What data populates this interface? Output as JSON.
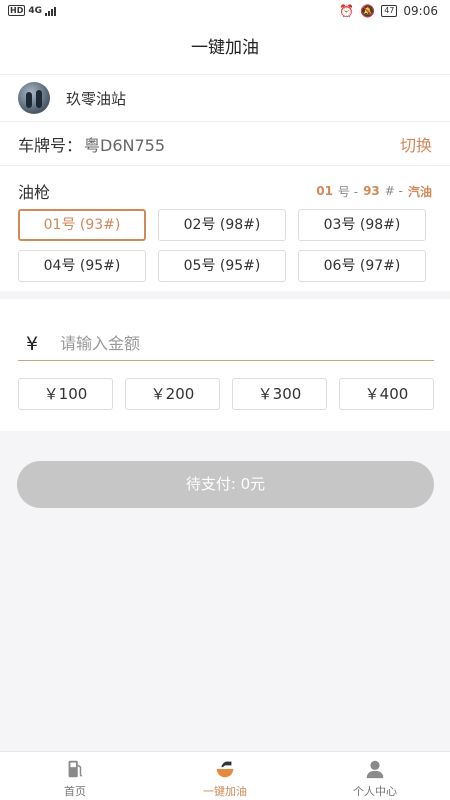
{
  "status_bar": {
    "hd": "HD",
    "network": "4G",
    "battery": "47",
    "time": "09:06"
  },
  "header": {
    "title": "一键加油"
  },
  "station": {
    "name": "玖零油站"
  },
  "plate": {
    "label": "车牌号：",
    "value": "粤D6N755",
    "switch_label": "切换"
  },
  "nozzles": {
    "title": "油枪",
    "summary": {
      "number": "01",
      "number_suffix": "号 -",
      "grade": "93",
      "grade_suffix": "# -",
      "fuel": "汽油"
    },
    "items": [
      {
        "label": "01号 (93#)"
      },
      {
        "label": "02号 (98#)"
      },
      {
        "label": "03号 (98#)"
      },
      {
        "label": "04号 (95#)"
      },
      {
        "label": "05号 (95#)"
      },
      {
        "label": "06号 (97#)"
      }
    ],
    "selected_index": 0
  },
  "amount": {
    "currency_symbol": "¥",
    "placeholder": "请输入金额",
    "quick_amounts": [
      {
        "label": "￥100"
      },
      {
        "label": "￥200"
      },
      {
        "label": "￥300"
      },
      {
        "label": "￥400"
      }
    ]
  },
  "payment": {
    "label": "待支付: 0元"
  },
  "tabbar": {
    "items": [
      {
        "label": "首页",
        "icon": "gas-pump-icon"
      },
      {
        "label": "一键加油",
        "icon": "fuel-drop-icon",
        "active": true
      },
      {
        "label": "个人中心",
        "icon": "person-icon"
      }
    ]
  },
  "colors": {
    "accent": "#d2895a",
    "pay_button_disabled": "#c6c6c6",
    "background": "#f5f5f7"
  }
}
